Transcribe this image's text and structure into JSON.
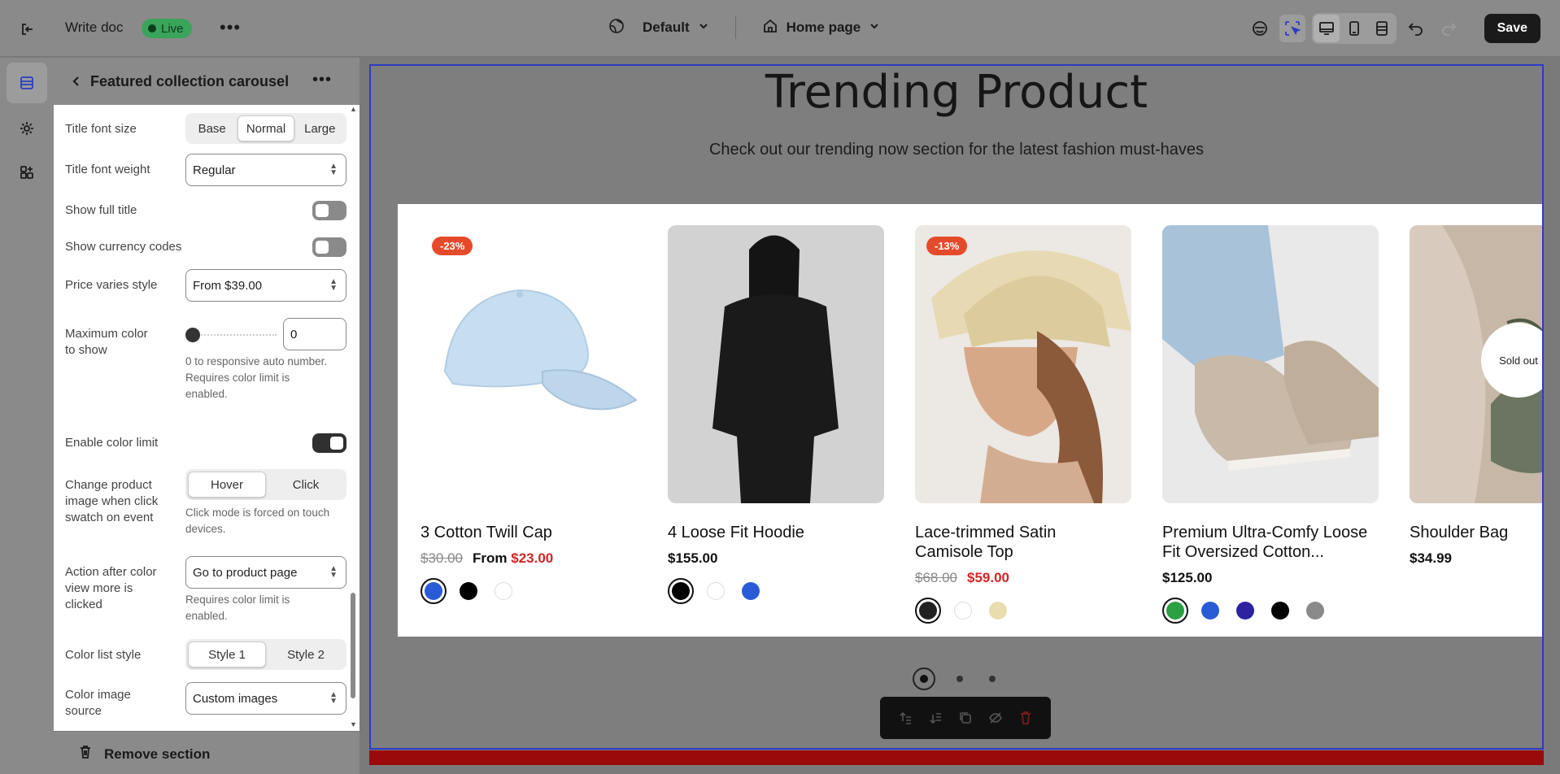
{
  "topbar": {
    "doc_title": "Write doc",
    "status": "Live",
    "theme": "Default",
    "page": "Home page",
    "save_label": "Save"
  },
  "panel": {
    "title": "Featured collection carousel",
    "fields": {
      "title_font_size": {
        "label": "Title font size",
        "options": [
          "Base",
          "Normal",
          "Large"
        ],
        "selected": "Normal"
      },
      "title_font_weight": {
        "label": "Title font weight",
        "value": "Regular"
      },
      "show_full_title": {
        "label": "Show full title",
        "on": false
      },
      "show_currency_codes": {
        "label": "Show currency codes",
        "on": false
      },
      "price_varies_style": {
        "label": "Price varies style",
        "value": "From $39.00"
      },
      "max_color": {
        "label_1": "Maximum color",
        "label_2": "to show",
        "value": "0",
        "hint_1": "0 to responsive auto number.",
        "hint_2": "Requires color limit is",
        "hint_3": "enabled."
      },
      "enable_color_limit": {
        "label": "Enable color limit",
        "on": true
      },
      "change_image": {
        "label_1": "Change product",
        "label_2": "image when click",
        "label_3": "swatch on event",
        "options": [
          "Hover",
          "Click"
        ],
        "selected": "Hover",
        "hint_1": "Click mode is forced on touch",
        "hint_2": "devices."
      },
      "action_after": {
        "label_1": "Action after color",
        "label_2": "view more is",
        "label_3": "clicked",
        "value": "Go to product page",
        "hint_1": "Requires color limit is",
        "hint_2": "enabled."
      },
      "color_list_style": {
        "label": "Color list style",
        "options": [
          "Style 1",
          "Style 2"
        ],
        "selected": "Style 1"
      },
      "color_image_source": {
        "label_1": "Color image",
        "label_2": "source",
        "value": "Custom images"
      }
    },
    "remove_label": "Remove section"
  },
  "preview": {
    "heading": "Trending Product",
    "subheading": "Check out our trending now section for the latest fashion must-haves",
    "products": [
      {
        "title": "3 Cotton Twill Cap",
        "badge": "-23%",
        "old_price": "$30.00",
        "price_prefix": "From ",
        "price": "$23.00",
        "colors": [
          "#2a5bd7",
          "#000000",
          "#ffffff"
        ]
      },
      {
        "title": "4 Loose Fit Hoodie",
        "price": "$155.00",
        "colors": [
          "#000000",
          "#ffffff",
          "#2a5bd7"
        ]
      },
      {
        "title_1": "Lace-trimmed Satin",
        "title_2": "Camisole Top",
        "badge": "-13%",
        "old_price": "$68.00",
        "price": "$59.00",
        "colors": [
          "#222222",
          "#ffffff",
          "#e9dcae"
        ]
      },
      {
        "title_1": "Premium Ultra-Comfy Loose",
        "title_2": "Fit Oversized Cotton...",
        "price": "$125.00",
        "colors": [
          "#2aa043",
          "#2a5bd7",
          "#2d22a0",
          "#000000",
          "#8a8a8a"
        ]
      },
      {
        "title": "Shoulder Bag",
        "price": "$34.99",
        "sold_out": "Sold out"
      }
    ]
  }
}
